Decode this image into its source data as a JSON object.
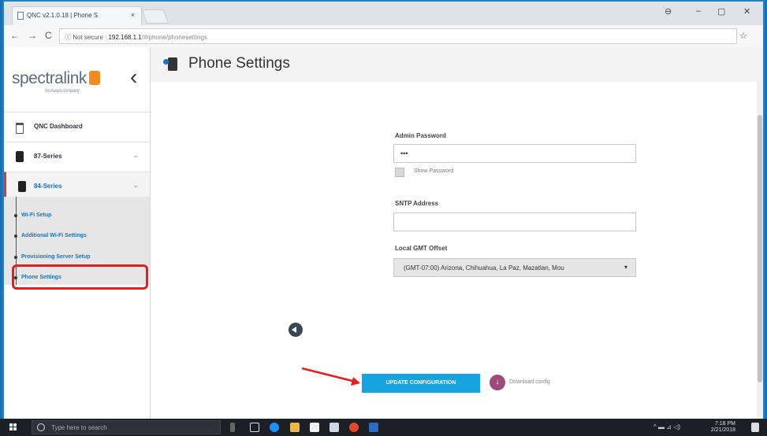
{
  "browser": {
    "tab_title": "QNC v2.1.0.18 | Phone S",
    "tab_close": "×",
    "window_controls": [
      "⊖",
      "–",
      "▢",
      "✕"
    ],
    "back": "←",
    "forward": "→",
    "reload": "C",
    "url_security": "ⓘ Not secure",
    "url_host": "192.168.1.1",
    "url_path": "/#/phone/phonesettings",
    "bookmark_star": "☆"
  },
  "sidebar": {
    "logo_text": "spectralink",
    "logo_tagline": "An Avaya company",
    "collapse_glyph": "‹",
    "menu": [
      {
        "label": "QNC Dashboard",
        "icon": "home-icon"
      },
      {
        "label": "87-Series",
        "icon": "phone-icon",
        "chevron": "⌄"
      },
      {
        "label": "84-Series",
        "icon": "phone-icon",
        "chevron": "⌄"
      }
    ],
    "submenu": [
      {
        "label": "Wi-Fi Setup"
      },
      {
        "label": "Additional Wi-Fi Settings"
      },
      {
        "label": "Provisioning Server Setup"
      },
      {
        "label": "Phone Settings"
      }
    ]
  },
  "main": {
    "page_title": "Phone Settings",
    "admin_password_label": "Admin Password",
    "admin_password_value": "•••",
    "show_password_label": "Show Password",
    "sntp_label": "SNTP Address",
    "sntp_value": "",
    "gmt_label": "Local GMT Offset",
    "gmt_value": "(GMT-07:00) Arizona, Chihuahua, La Paz, Mazatlan, Mou",
    "gmt_caret": "▾",
    "update_button": "UPDATE CONFIGURATION",
    "download_glyph": "↓",
    "download_label": "Download config"
  },
  "taskbar": {
    "search_placeholder": "Type here to search",
    "tray_icons": "^ ▬ ⊿ ◁)",
    "time": "7:18 PM",
    "date": "2/21/2018"
  },
  "colors": {
    "accent_blue": "#17a3e0",
    "highlight_red": "#e21f1f",
    "link_blue": "#1a73c9",
    "download_purple": "#9d4a78"
  }
}
